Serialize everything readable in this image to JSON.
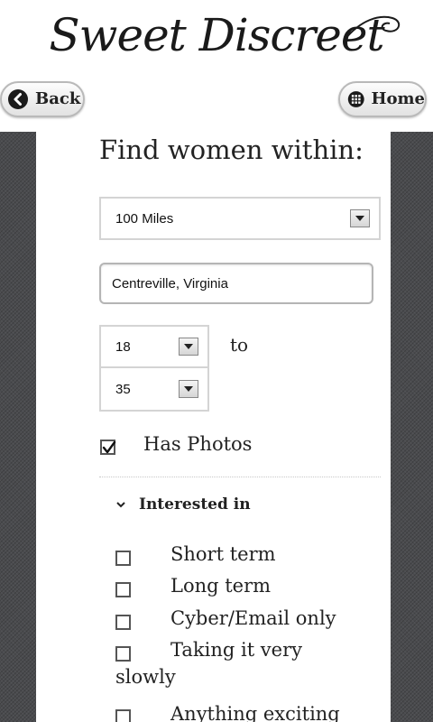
{
  "header": {
    "logo_text": "Sweet Discreet",
    "back_label": "Back",
    "home_label": "Home",
    "back_icon": "back-arrow-icon",
    "home_icon": "grid-globe-icon"
  },
  "search": {
    "heading": "Find women within:",
    "distance_value": "100 Miles",
    "location_value": "Centreville, Virginia",
    "age_min": "18",
    "age_max": "35",
    "to_label": "to",
    "has_photos_label": "Has Photos",
    "has_photos_checked": true
  },
  "interested": {
    "header": "Interested in",
    "options": [
      {
        "label": "Short term",
        "checked": false
      },
      {
        "label": "Long term",
        "checked": false
      },
      {
        "label": "Cyber/Email only",
        "checked": false
      },
      {
        "label": "Taking it very",
        "checked": false
      },
      {
        "label": "slowly"
      },
      {
        "label": "Anything exciting",
        "checked": false
      }
    ]
  },
  "colors": {
    "panel_texture": "#4a4b4e",
    "button_border": "#b9b9b9"
  }
}
